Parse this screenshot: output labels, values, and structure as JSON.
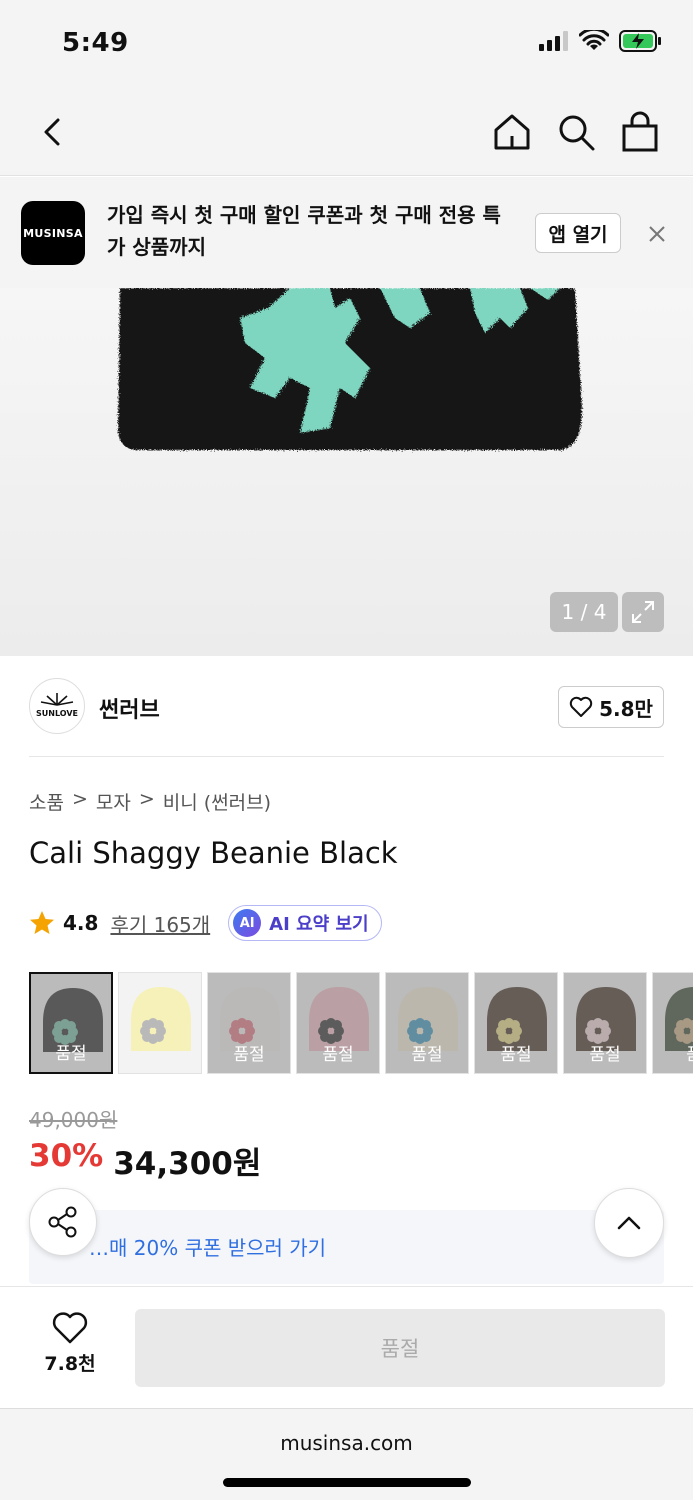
{
  "status": {
    "time": "5:49"
  },
  "banner": {
    "logo_text": "MUSINSA",
    "text": "가입 즉시 첫 구매 할인 쿠폰과 첫 구매 전용 특가 상품까지",
    "open_app_label": "앱 열기"
  },
  "hero": {
    "counter": "1 / 4"
  },
  "brand": {
    "name": "썬러브",
    "logo_text": "SUNLOVE",
    "likes": "5.8만"
  },
  "breadcrumb": [
    "소품",
    ">",
    "모자",
    ">",
    "비니 (썬러브)"
  ],
  "product": {
    "title": "Cali Shaggy Beanie Black",
    "rating": "4.8",
    "review_label": "후기 165개",
    "ai_badge": "AI",
    "ai_label": "AI 요약 보기"
  },
  "swatches": [
    {
      "hat": "#1c1c1c",
      "flower": "#6cb8a0",
      "sold": "품절"
    },
    {
      "hat": "#f6f1b8",
      "flower": "#b9b9b9",
      "sold": ""
    },
    {
      "hat": "#f4f0ea",
      "flower": "#e06a78",
      "sold": "품절"
    },
    {
      "hat": "#f2b7c0",
      "flower": "#222222",
      "sold": "품절"
    },
    {
      "hat": "#f4ecd6",
      "flower": "#2a8fb8",
      "sold": "품절"
    },
    {
      "hat": "#3a2418",
      "flower": "#e6d77a",
      "sold": "품절"
    },
    {
      "hat": "#3a2418",
      "flower": "#f2d0d6",
      "sold": "품절"
    },
    {
      "hat": "#2a3a22",
      "flower": "#c9a97a",
      "sold": "품"
    }
  ],
  "price": {
    "original": "49,000원",
    "discount": "30%",
    "final": "34,300원"
  },
  "coupon": {
    "text": "…매 20% 쿠폰 받으러 가기"
  },
  "bottom": {
    "wish_count": "7.8천",
    "sold_out": "품절"
  },
  "browser": {
    "url": "musinsa.com"
  },
  "colors": {
    "accent_red": "#e53935",
    "link_blue": "#2f6fe0",
    "ai_purple": "#4b3fc9",
    "beanie_mint": "#7fd6c0"
  }
}
